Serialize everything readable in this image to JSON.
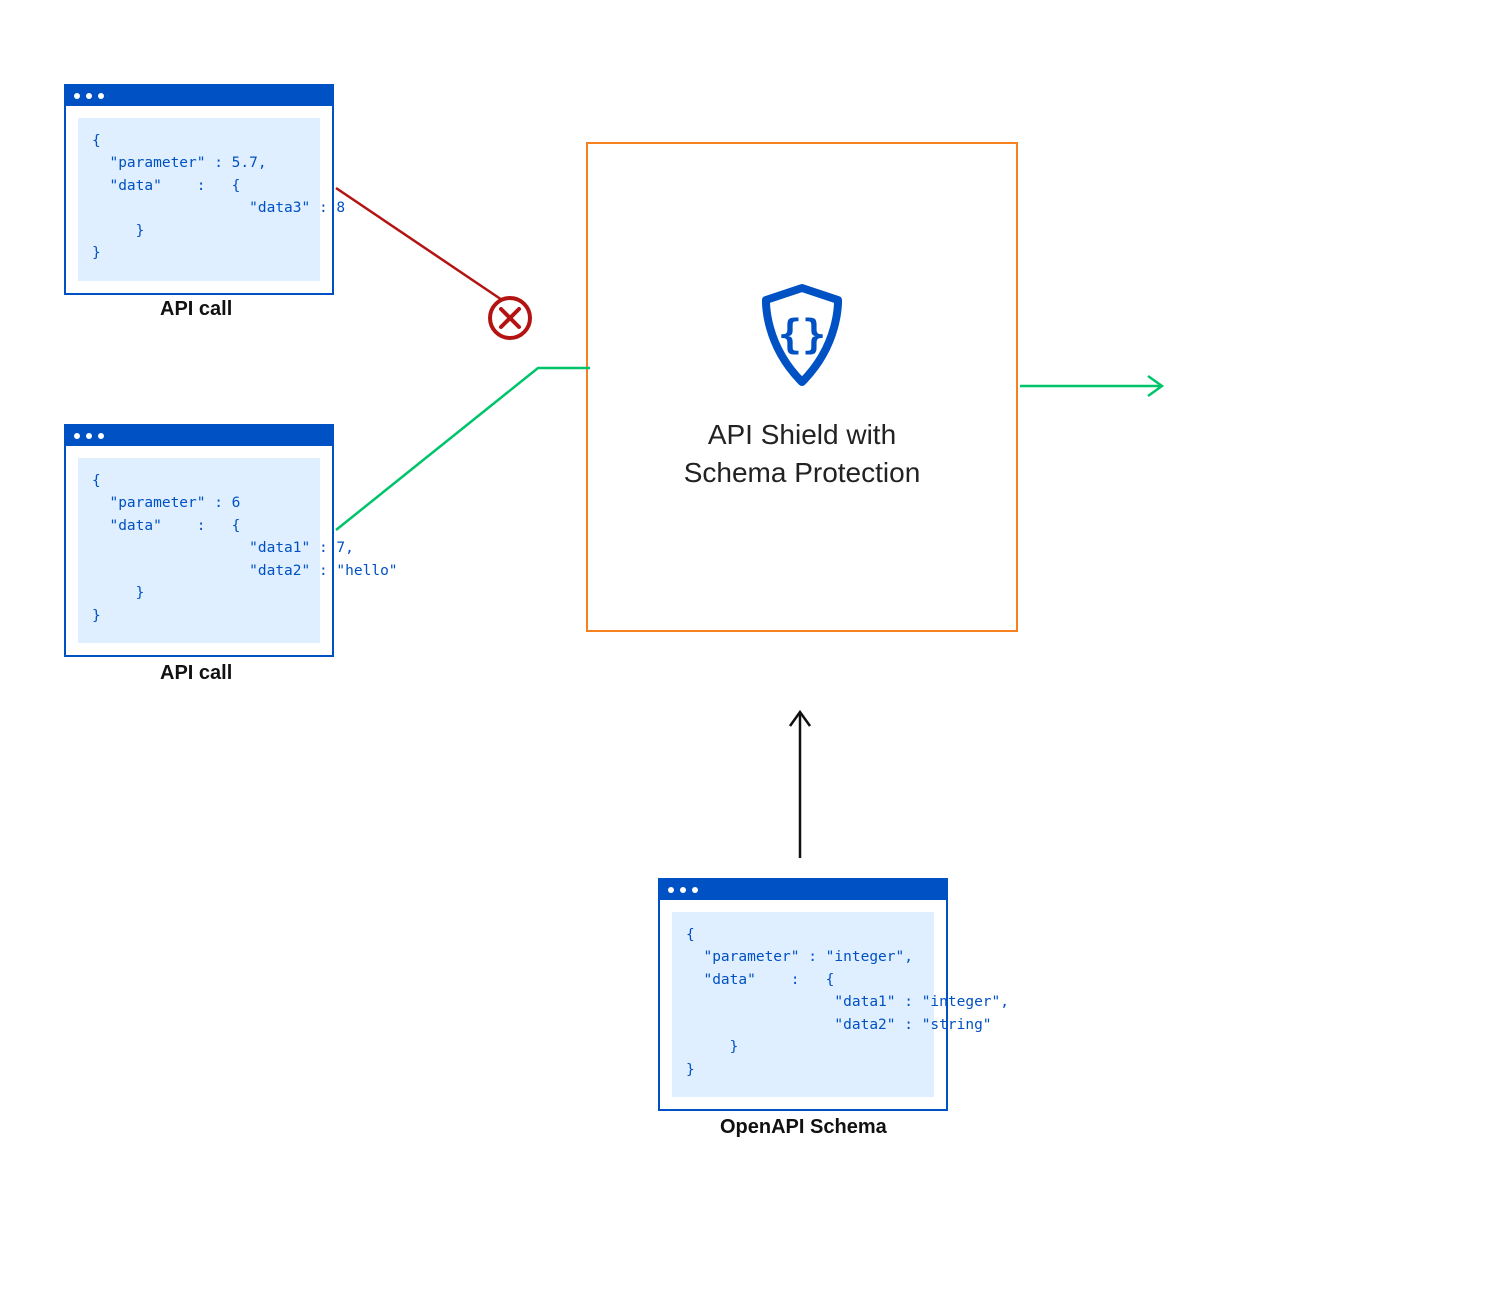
{
  "windows": {
    "call1": {
      "code": "{\n  \"parameter\" : 5.7,\n  \"data\"    :   {\n                  \"data3\" : 8\n     }\n}"
    },
    "call2": {
      "code": "{\n  \"parameter\" : 6\n  \"data\"    :   {\n                  \"data1\" : 7,\n                  \"data2\" : \"hello\"\n     }\n}"
    },
    "schema": {
      "code": "{\n  \"parameter\" : \"integer\",\n  \"data\"    :   {\n                 \"data1\" : \"integer\",\n                 \"data2\" : \"string\"\n     }\n}"
    }
  },
  "labels": {
    "call1": "API call",
    "call2": "API call",
    "schema": "OpenAPI Schema",
    "shield_line1": "API Shield with",
    "shield_line2": "Schema Protection"
  },
  "colors": {
    "blue": "#0051c3",
    "orange": "#f6821f",
    "green": "#00c46a",
    "red": "#b31412"
  }
}
